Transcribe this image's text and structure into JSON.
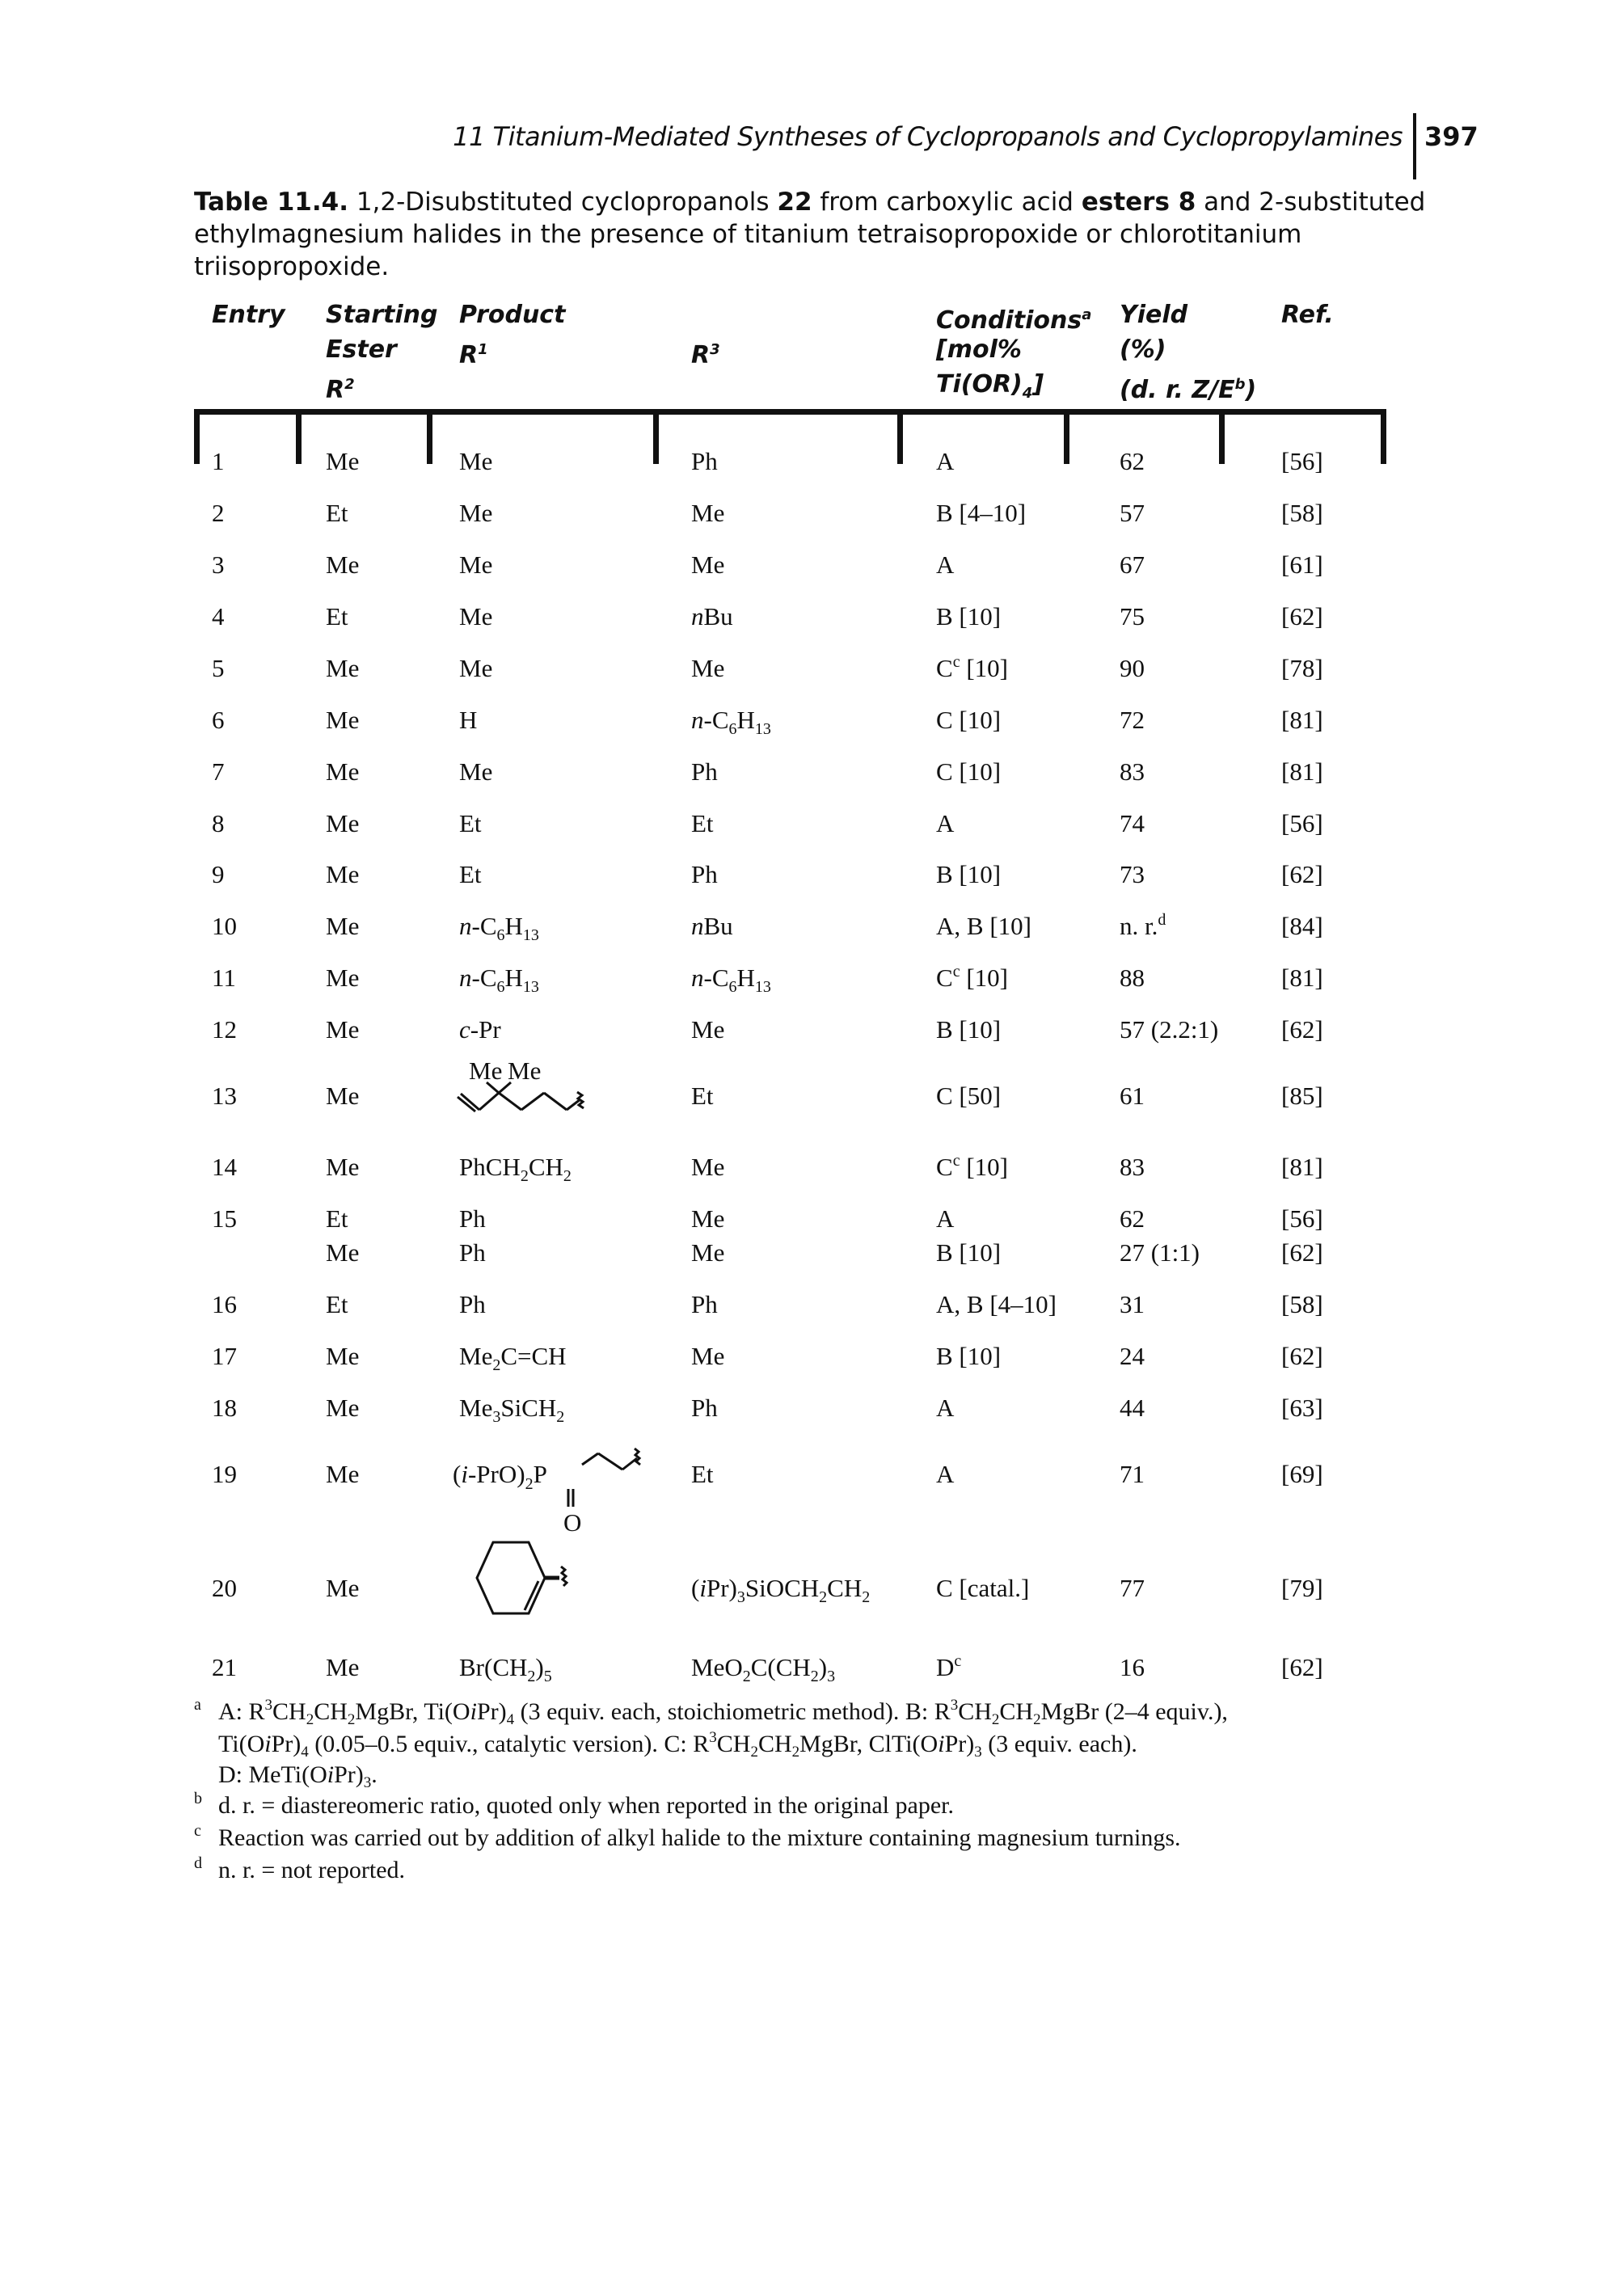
{
  "header": {
    "running_title": "11  Titanium-Mediated Syntheses of Cyclopropanols and Cyclopropylamines",
    "page_number": "397"
  },
  "caption": {
    "label": "Table 11.4.",
    "parts": [
      {
        "text": "  1,2-Disubstituted cyclopropanols ",
        "bold": false
      },
      {
        "text": "22",
        "bold": true
      },
      {
        "text": " from carboxylic acid ",
        "bold": false
      },
      {
        "text": "esters 8",
        "bold": true
      },
      {
        "text": " and 2-substituted ethylmagnesium halides in the presence of titanium tetraisopropoxide or chlorotitanium triisopropoxide.",
        "bold": false
      }
    ]
  },
  "columns": [
    {
      "key": "entry",
      "lines": [
        "Entry"
      ]
    },
    {
      "key": "ester",
      "lines": [
        "Starting",
        "Ester",
        "R²"
      ]
    },
    {
      "key": "r1",
      "lines": [
        "Product",
        "R¹"
      ]
    },
    {
      "key": "r3",
      "lines": [
        "",
        "R³"
      ]
    },
    {
      "key": "conditions",
      "lines": [
        "Conditionsᵃ",
        "[mol%",
        "Ti(OR)₄]"
      ]
    },
    {
      "key": "yield",
      "lines": [
        "Yield",
        "(%)",
        "(d. r. Z/Eᵇ)"
      ]
    },
    {
      "key": "ref",
      "lines": [
        "Ref."
      ]
    }
  ],
  "rows": [
    {
      "entry": "1",
      "ester": "Me",
      "r1": "Me",
      "r3": "Ph",
      "conditions": "A",
      "yield": "62",
      "ref": "[56]"
    },
    {
      "entry": "2",
      "ester": "Et",
      "r1": "Me",
      "r3": "Me",
      "conditions": "B [4–10]",
      "yield": "57",
      "ref": "[58]"
    },
    {
      "entry": "3",
      "ester": "Me",
      "r1": "Me",
      "r3": "Me",
      "conditions": "A",
      "yield": "67",
      "ref": "[61]"
    },
    {
      "entry": "4",
      "ester": "Et",
      "r1": "Me",
      "r3": "<i>n</i>Bu",
      "conditions": "B [10]",
      "yield": "75",
      "ref": "[62]"
    },
    {
      "entry": "5",
      "ester": "Me",
      "r1": "Me",
      "r3": "Me",
      "conditions": "C<sup>c</sup> [10]",
      "yield": "90",
      "ref": "[78]"
    },
    {
      "entry": "6",
      "ester": "Me",
      "r1": "H",
      "r3": "<i>n</i>-C<sub>6</sub>H<sub>13</sub>",
      "conditions": "C [10]",
      "yield": "72",
      "ref": "[81]"
    },
    {
      "entry": "7",
      "ester": "Me",
      "r1": "Me",
      "r3": "Ph",
      "conditions": "C [10]",
      "yield": "83",
      "ref": "[81]"
    },
    {
      "entry": "8",
      "ester": "Me",
      "r1": "Et",
      "r3": "Et",
      "conditions": "A",
      "yield": "74",
      "ref": "[56]"
    },
    {
      "entry": "9",
      "ester": "Me",
      "r1": "Et",
      "r3": "Ph",
      "conditions": "B [10]",
      "yield": "73",
      "ref": "[62]"
    },
    {
      "entry": "10",
      "ester": "Me",
      "r1": "<i>n</i>-C<sub>6</sub>H<sub>13</sub>",
      "r3": "<i>n</i>Bu",
      "conditions": "A, B [10]",
      "yield": "n. r.<sup>d</sup>",
      "ref": "[84]"
    },
    {
      "entry": "11",
      "ester": "Me",
      "r1": "<i>n</i>-C<sub>6</sub>H<sub>13</sub>",
      "r3": "<i>n</i>-C<sub>6</sub>H<sub>13</sub>",
      "conditions": "C<sup>c</sup> [10]",
      "yield": "88",
      "ref": "[81]"
    },
    {
      "entry": "12",
      "ester": "Me",
      "r1": "<i>c</i>-Pr",
      "r3": "Me",
      "conditions": "B [10]",
      "yield": "57 (2.2:1)",
      "ref": "[62]"
    },
    {
      "entry": "13",
      "ester": "Me",
      "r1": "",
      "r1_structure": "3,3-dimethylpent-4-enyl",
      "r1_labels": [
        "Me",
        "Me"
      ],
      "r3": "Et",
      "conditions": "C [50]",
      "yield": "61",
      "ref": "[85]"
    },
    {
      "entry": "14",
      "ester": "Me",
      "r1": "PhCH<sub>2</sub>CH<sub>2</sub>",
      "r3": "Me",
      "conditions": "C<sup>c</sup> [10]",
      "yield": "83",
      "ref": "[81]"
    },
    {
      "entry": "15",
      "ester": "Et",
      "r1": "Ph",
      "r3": "Me",
      "conditions": "A",
      "yield": "62",
      "ref": "[56]"
    },
    {
      "entry": "",
      "ester": "Me",
      "r1": "Ph",
      "r3": "Me",
      "conditions": "B [10]",
      "yield": "27 (1:1)",
      "ref": "[62]"
    },
    {
      "entry": "16",
      "ester": "Et",
      "r1": "Ph",
      "r3": "Ph",
      "conditions": "A, B [4–10]",
      "yield": "31",
      "ref": "[58]"
    },
    {
      "entry": "17",
      "ester": "Me",
      "r1": "Me<sub>2</sub>C=CH",
      "r3": "Me",
      "conditions": "B [10]",
      "yield": "24",
      "ref": "[62]"
    },
    {
      "entry": "18",
      "ester": "Me",
      "r1": "Me<sub>3</sub>SiCH<sub>2</sub>",
      "r3": "Ph",
      "conditions": "A",
      "yield": "44",
      "ref": "[63]"
    },
    {
      "entry": "19",
      "ester": "Me",
      "r1": "",
      "r1_structure": "diisopropoxyphosphorylethyl",
      "r1_labels": [
        "(",
        "i",
        "-PrO)",
        "2",
        "P",
        "O"
      ],
      "r3": "Et",
      "conditions": "A",
      "yield": "71",
      "ref": "[69]"
    },
    {
      "entry": "20",
      "ester": "Me",
      "r1": "",
      "r1_structure": "cyclohex-1-enyl",
      "r3": "(<i>i</i>Pr)<sub>3</sub>SiOCH<sub>2</sub>CH<sub>2</sub>",
      "conditions": "C [catal.]",
      "yield": "77",
      "ref": "[79]"
    },
    {
      "entry": "21",
      "ester": "Me",
      "r1": "Br(CH<sub>2</sub>)<sub>5</sub>",
      "r3": "MeO<sub>2</sub>C(CH<sub>2</sub>)<sub>3</sub>",
      "conditions": "D<sup>c</sup>",
      "yield": "16",
      "ref": "[62]"
    }
  ],
  "footnotes": [
    {
      "mark": "a",
      "lines": [
        "A: R<sup>3</sup>CH<sub>2</sub>CH<sub>2</sub>MgBr, Ti(O<i>i</i>Pr)<sub>4</sub> (3 equiv. each, stoichiometric method). B: R<sup>3</sup>CH<sub>2</sub>CH<sub>2</sub>MgBr (2–4 equiv.),",
        "Ti(O<i>i</i>Pr)<sub>4</sub> (0.05–0.5 equiv., catalytic version). C: R<sup>3</sup>CH<sub>2</sub>CH<sub>2</sub>MgBr, ClTi(O<i>i</i>Pr)<sub>3</sub> (3 equiv. each).",
        "D: MeTi(O<i>i</i>Pr)<sub>3</sub>."
      ]
    },
    {
      "mark": "b",
      "lines": [
        "d. r. = diastereomeric ratio, quoted only when reported in the original paper."
      ]
    },
    {
      "mark": "c",
      "lines": [
        "Reaction was carried out by addition of alkyl halide to the mixture containing magnesium turnings."
      ]
    },
    {
      "mark": "d",
      "lines": [
        "n. r. = not reported."
      ]
    }
  ]
}
